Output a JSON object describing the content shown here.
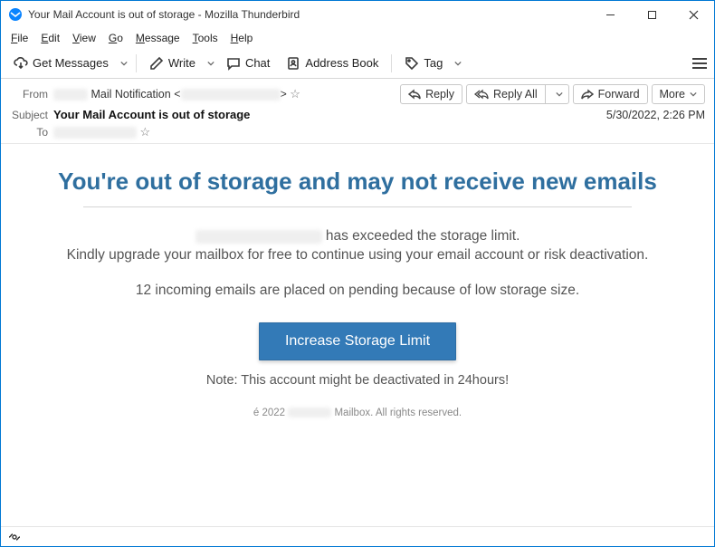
{
  "window": {
    "title": "Your Mail Account is out of storage - Mozilla Thunderbird"
  },
  "menu": {
    "file": "File",
    "edit": "Edit",
    "view": "View",
    "go": "Go",
    "message": "Message",
    "tools": "Tools",
    "help": "Help"
  },
  "toolbar": {
    "get_messages": "Get Messages",
    "write": "Write",
    "chat": "Chat",
    "address_book": "Address Book",
    "tag": "Tag"
  },
  "headers": {
    "from_label": "From",
    "from_name": "Mail Notification",
    "from_addr_prefix": "<",
    "from_addr_suffix": ">",
    "subject_label": "Subject",
    "subject": "Your Mail Account is out of storage",
    "to_label": "To",
    "datetime": "5/30/2022, 2:26 PM"
  },
  "actions": {
    "reply": "Reply",
    "reply_all": "Reply All",
    "forward": "Forward",
    "more": "More"
  },
  "message": {
    "headline": "You're out of storage and may not receive new emails",
    "p1_suffix": " has exceeded the storage limit.",
    "p1b": "Kindly upgrade your mailbox for free to continue using your email account or risk deactivation.",
    "p2": "12 incoming emails are placed on pending because of low storage size.",
    "cta": "Increase Storage Limit",
    "note": "Note: This account might be deactivated in 24hours!",
    "footer_prefix": "é 2022 ",
    "footer_suffix": " Mailbox. All rights reserved."
  }
}
